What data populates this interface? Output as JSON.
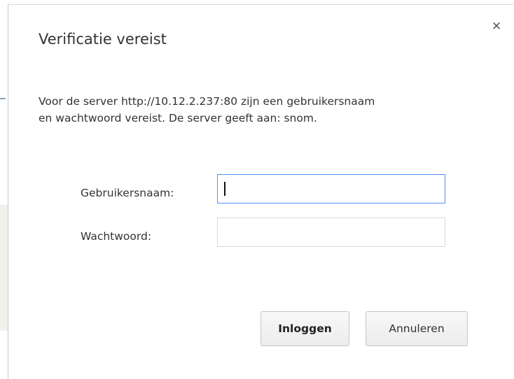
{
  "dialog": {
    "title": "Verificatie vereist",
    "close_icon": "close-icon",
    "close_glyph": "✕",
    "message_line1": "Voor de server http://10.12.2.237:80 zijn een gebruikersnaam",
    "message_line2": "en wachtwoord vereist. De server geeft aan: snom.",
    "form": {
      "username_label": "Gebruikersnaam:",
      "username_value": "",
      "password_label": "Wachtwoord:",
      "password_value": ""
    },
    "buttons": {
      "login_label": "Inloggen",
      "cancel_label": "Annuleren"
    }
  },
  "colors": {
    "focus_border": "#4d90fe",
    "text": "#333333",
    "field_border": "#d9d9d9"
  }
}
